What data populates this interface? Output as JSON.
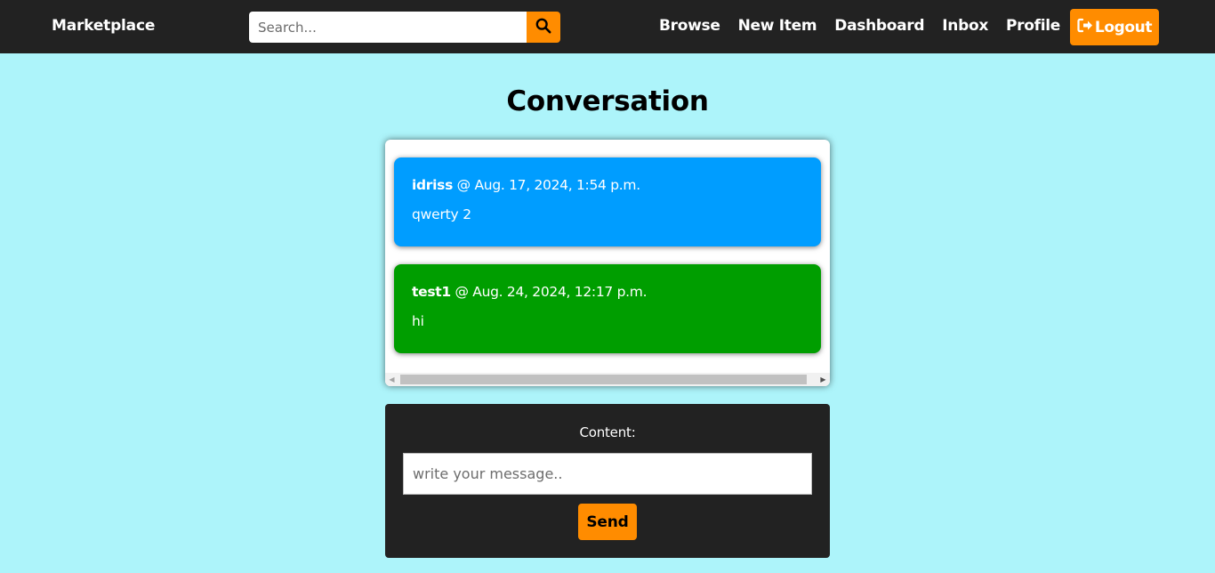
{
  "navbar": {
    "brand": "Marketplace",
    "search_placeholder": "Search...",
    "links": [
      "Browse",
      "New Item",
      "Dashboard",
      "Inbox",
      "Profile"
    ],
    "logout_label": "Logout",
    "accent_color": "#ff8c00",
    "background_color": "#222222"
  },
  "page": {
    "title": "Conversation",
    "background_color": "#adf4fa"
  },
  "messages": [
    {
      "user": "idriss",
      "timestamp": "@ Aug. 17, 2024, 1:54 p.m.",
      "content": "qwerty 2",
      "color": "#009dff"
    },
    {
      "user": "test1",
      "timestamp": "@ Aug. 24, 2024, 12:17 p.m.",
      "content": "hi",
      "color": "#009e00"
    }
  ],
  "form": {
    "content_label": "Content:",
    "message_placeholder": "write your message..",
    "send_label": "Send"
  },
  "icons": {
    "search": "magnifier-icon",
    "logout": "sign-out-icon"
  }
}
